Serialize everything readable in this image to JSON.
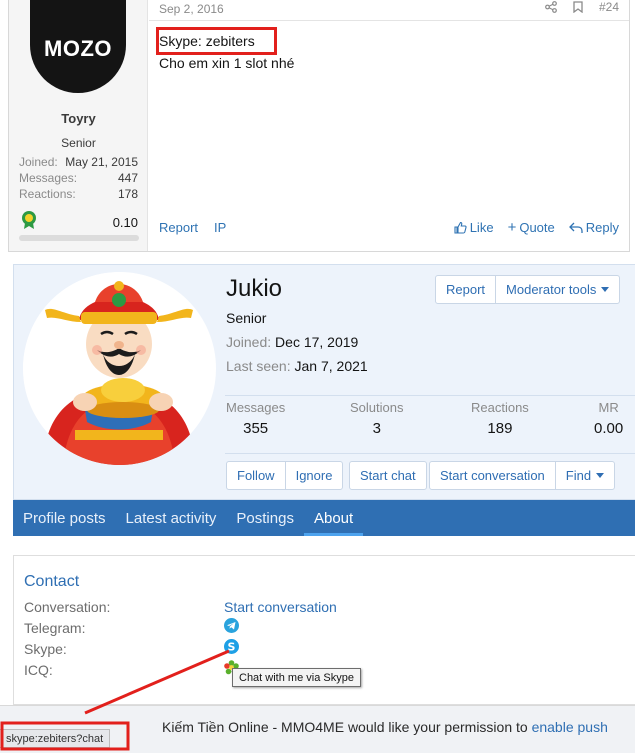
{
  "post": {
    "user": {
      "avatar_text": "MOZO",
      "name": "Toyry",
      "title": "Senior",
      "stats": [
        {
          "label": "Joined:",
          "value": "May 21, 2015"
        },
        {
          "label": "Messages:",
          "value": "447"
        },
        {
          "label": "Reactions:",
          "value": "178"
        }
      ],
      "trophy_value": "0.10"
    },
    "date": "Sep 2, 2016",
    "number": "#24",
    "content": {
      "line1": "Skype: zebiters",
      "line2": "Cho em xin 1 slot nhé"
    },
    "actions_left": [
      "Report",
      "IP"
    ],
    "actions_right": {
      "like": "Like",
      "quote": "Quote",
      "reply": "Reply"
    }
  },
  "profile": {
    "name": "Jukio",
    "title": "Senior",
    "joined_label": "Joined:",
    "joined_value": "Dec 17, 2019",
    "lastseen_label": "Last seen:",
    "lastseen_value": "Jan 7, 2021",
    "stats": [
      {
        "label": "Messages",
        "value": "355"
      },
      {
        "label": "Solutions",
        "value": "3"
      },
      {
        "label": "Reactions",
        "value": "189"
      },
      {
        "label": "MR",
        "value": "0.00"
      }
    ],
    "buttons": {
      "report": "Report",
      "moderator_tools": "Moderator tools",
      "follow": "Follow",
      "ignore": "Ignore",
      "start_chat": "Start chat",
      "start_conversation": "Start conversation",
      "find": "Find"
    }
  },
  "tabs": [
    {
      "label": "Profile posts",
      "active": false
    },
    {
      "label": "Latest activity",
      "active": false
    },
    {
      "label": "Postings",
      "active": false
    },
    {
      "label": "About",
      "active": true
    }
  ],
  "contact": {
    "heading": "Contact",
    "rows": {
      "conversation": {
        "label": "Conversation:",
        "value": "Start conversation"
      },
      "telegram": {
        "label": "Telegram:"
      },
      "skype": {
        "label": "Skype:"
      },
      "icq": {
        "label": "ICQ:"
      }
    },
    "tooltip": "Chat with me via Skype"
  },
  "banner": {
    "text": "Kiếm Tiền Online - MMO4ME would like your permission to ",
    "link": "enable push"
  },
  "status_url": "skype:zebiters?chat",
  "colors": {
    "accent": "#2f6fb3",
    "highlight": "#e2201c",
    "profile_bg": "#edf3fb"
  }
}
